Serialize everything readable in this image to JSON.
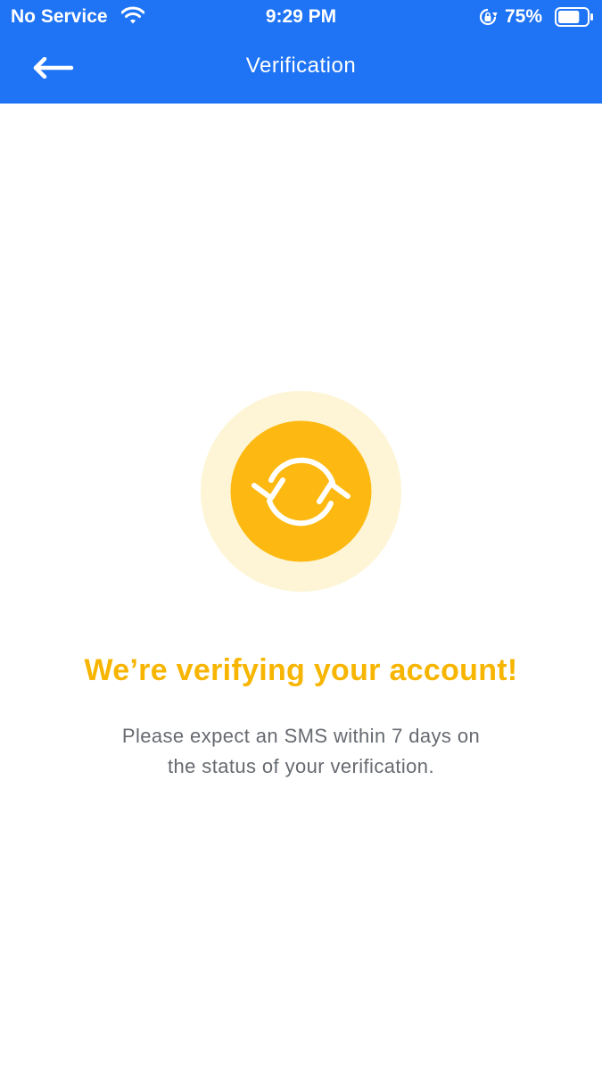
{
  "status_bar": {
    "carrier": "No Service",
    "time": "9:29 PM",
    "battery_percent": "75%",
    "battery_level": 0.75,
    "icons": [
      "wifi-icon",
      "rotation-lock-icon",
      "battery-icon"
    ]
  },
  "nav": {
    "title": "Verification",
    "back_icon": "arrow-left-icon"
  },
  "content": {
    "graphic_icon": "sync-arrows-icon",
    "headline": "We’re verifying your account!",
    "message_line1": "Please expect an SMS within 7 days on",
    "message_line2": "the status of your verification."
  },
  "colors": {
    "header_bg": "#1f74f5",
    "accent": "#f7b500",
    "accent_light": "#fdf5d6",
    "text_muted": "#666a70"
  }
}
